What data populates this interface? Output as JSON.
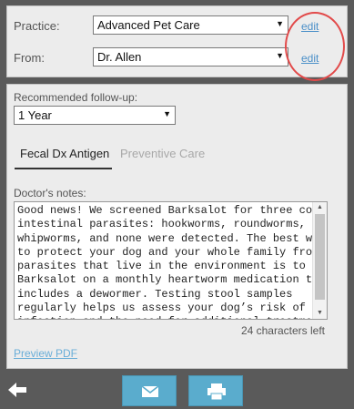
{
  "form": {
    "practice_label": "Practice:",
    "practice_value": "Advanced Pet Care",
    "from_label": "From:",
    "from_value": "Dr. Allen",
    "edit_label": "edit"
  },
  "followup": {
    "label": "Recommended follow-up:",
    "value": "1 Year"
  },
  "tabs": [
    {
      "label": "Fecal Dx Antigen",
      "active": true
    },
    {
      "label": "Preventive Care",
      "active": false
    }
  ],
  "notes": {
    "label": "Doctor's notes:",
    "text": "Good news! We screened Barksalot for three common\nintestinal parasites: hookworms, roundworms, and\nwhipworms, and none were detected. The best way\nto protect your dog and your whole family from\nparasites that live in the environment is to keep\nBarksalot on a monthly heartworm medication that\nincludes a dewormer. Testing stool samples\nregularly helps us assess your dog’s risk of\ninfection and the need for additional treatment.",
    "chars_left": "24 characters left"
  },
  "preview_label": "Preview PDF",
  "icons": {
    "back": "back-arrow-icon",
    "email": "envelope-icon",
    "print": "printer-icon",
    "dropdown": "caret-down-icon"
  },
  "colors": {
    "accent": "#5aaccd",
    "link": "#4a8fc8",
    "highlight": "#e24a4a",
    "footer_bg": "#5a5a5a",
    "panel_bg": "#ececec"
  }
}
